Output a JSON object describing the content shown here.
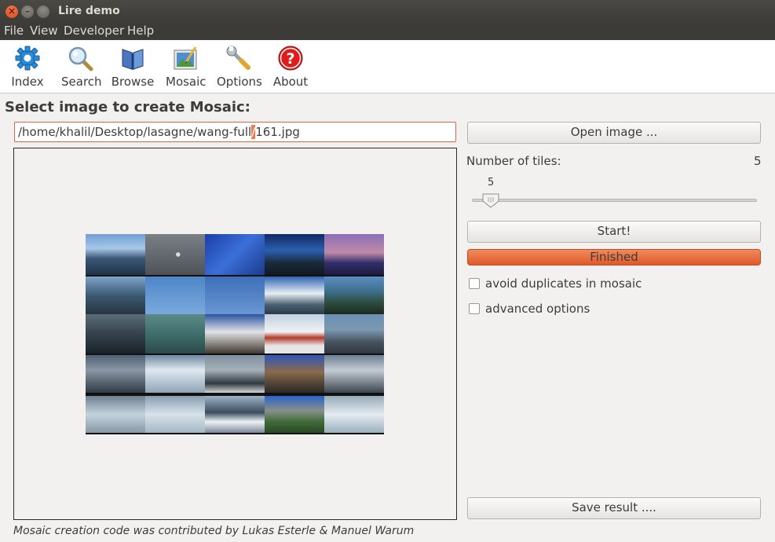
{
  "window": {
    "title": "Lire demo",
    "close_glyph": "×",
    "min_glyph": "–"
  },
  "menu": [
    "File",
    "View",
    "Developer",
    "Help"
  ],
  "toolbar": [
    {
      "label": "Index",
      "icon": "gear-icon"
    },
    {
      "label": "Search",
      "icon": "magnifier-icon"
    },
    {
      "label": "Browse",
      "icon": "book-icon"
    },
    {
      "label": "Mosaic",
      "icon": "mosaic-icon"
    },
    {
      "label": "Options",
      "icon": "wrench-icon"
    },
    {
      "label": "About",
      "icon": "help-icon"
    }
  ],
  "heading": "Select image to create Mosaic:",
  "path": {
    "before": "/home/khalil/Desktop/lasagne/wang-full",
    "selected": "/",
    "after": "161.jpg"
  },
  "open_button": "Open image ...",
  "tiles_label": "Number of tiles:",
  "tiles_value": "5",
  "slider": {
    "value": "5",
    "min": 1,
    "max": 50
  },
  "start_button": "Start!",
  "progress": {
    "text": "Finished",
    "percent": 100
  },
  "checkboxes": [
    {
      "label": "avoid duplicates in mosaic",
      "checked": false
    },
    {
      "label": "advanced options",
      "checked": false
    }
  ],
  "save_button": "Save result ....",
  "footer": "Mosaic creation code was contributed by Lukas Esterle & Manuel Warum",
  "colors": {
    "accent": "#e8642f",
    "titlebar": "#3c3b37",
    "background": "#f2f1f0"
  }
}
